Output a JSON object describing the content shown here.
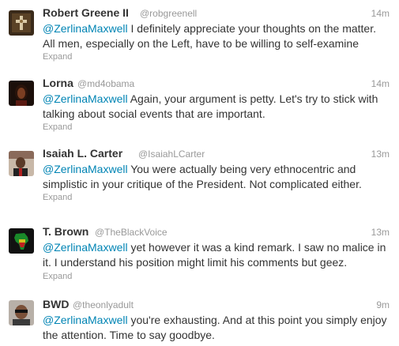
{
  "tweets": [
    {
      "name": "Robert Greene II",
      "handle": "@robgreenell",
      "time": "14m",
      "mention": "@ZerlinaMaxwell",
      "text": " I definitely appreciate your thoughts on the matter. All men, especially on the Left, have to be willing to self-examine",
      "expand": "Expand",
      "avatar_icon": "dark-cross-avatar"
    },
    {
      "name": "Lorna",
      "handle": "@md4obama",
      "time": "14m",
      "mention": "@ZerlinaMaxwell",
      "text": " Again, your argument is petty. Let's try to stick with talking about social events that are important.",
      "expand": "Expand",
      "avatar_icon": "woman-portrait-avatar"
    },
    {
      "name": "Isaiah L. Carter",
      "handle": "@IsaiahLCarter",
      "time": "13m",
      "mention": "@ZerlinaMaxwell",
      "text": " You were actually being very ethnocentric and simplistic in your critique of the President. Not complicated either.",
      "expand": "Expand",
      "avatar_icon": "man-portrait-avatar"
    },
    {
      "name": "T. Brown",
      "handle": "@TheBlackVoice",
      "time": "13m",
      "mention": "@ZerlinaMaxwell",
      "text": " yet however it was a kind remark. I saw no malice in it. I understand his position might limit his comments but geez.",
      "expand": "Expand",
      "avatar_icon": "africa-map-avatar"
    },
    {
      "name": "BWD",
      "handle": "@theonlyadult",
      "time": "9m",
      "mention": "@ZerlinaMaxwell",
      "text": " you're exhausting. And at this point you simply enjoy the attention. Time to say goodbye.",
      "avatar_icon": "man-sunglasses-avatar"
    }
  ]
}
